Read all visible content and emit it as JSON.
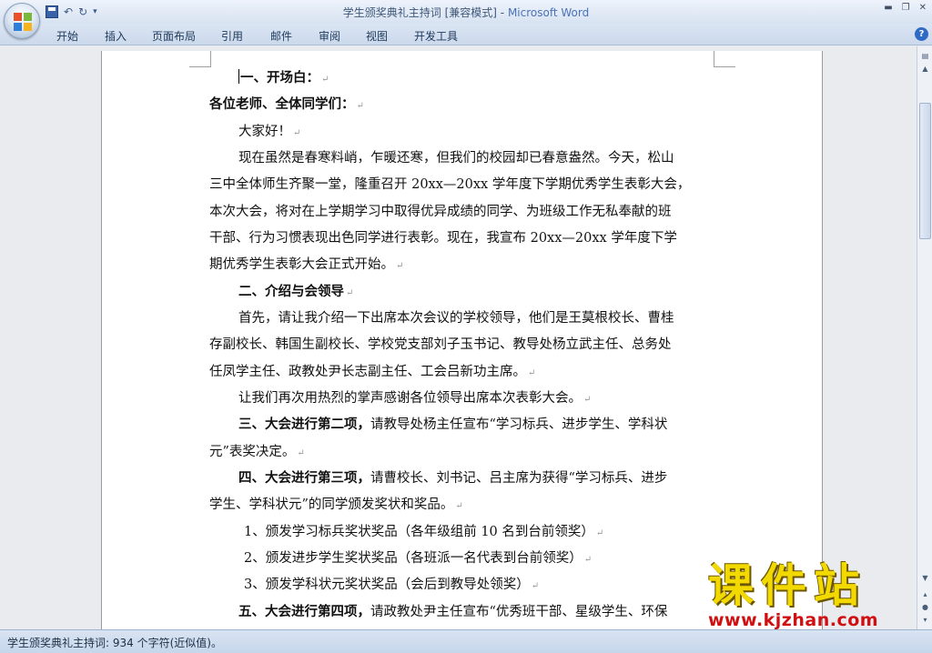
{
  "window": {
    "title": "学生颁奖典礼主持词 [兼容模式]",
    "title_sep": " - ",
    "app_name": "Microsoft Word"
  },
  "qat": {
    "undo": "↶",
    "redo": "↻",
    "customize": "▾"
  },
  "ribbon": {
    "tabs": [
      "开始",
      "插入",
      "页面布局",
      "引用",
      "邮件",
      "审阅",
      "视图",
      "开发工具"
    ],
    "help": "?"
  },
  "document": {
    "lines": [
      {
        "text": "一、开场白：",
        "bold": true
      },
      {
        "text": "各位老师、全体同学们：",
        "bold": true
      },
      {
        "text": "大家好！"
      },
      {
        "text": "现在虽然是春寒料峭，乍暖还寒，但我们的校园却已春意盎然。今天，松山"
      },
      {
        "text": "三中全体师生齐聚一堂，隆重召开 20xx—20xx 学年度下学期优秀学生表彰大会，"
      },
      {
        "text": "本次大会，将对在上学期学习中取得优异成绩的同学、为班级工作无私奉献的班"
      },
      {
        "text": "干部、行为习惯表现出色同学进行表彰。现在，我宣布 20xx—20xx 学年度下学"
      },
      {
        "text": "期优秀学生表彰大会正式开始。"
      },
      {
        "text": "二、介绍与会领导",
        "bold": true
      },
      {
        "text": "首先，请让我介绍一下出席本次会议的学校领导，他们是王莫根校长、曹桂"
      },
      {
        "text": "存副校长、韩国生副校长、学校党支部刘子玉书记、教导处杨立武主任、总务处"
      },
      {
        "text": "任凤学主任、政教处尹长志副主任、工会吕新功主席。"
      },
      {
        "text": "让我们再次用热烈的掌声感谢各位领导出席本次表彰大会。"
      },
      {
        "bold_part": "三、大会进行第二项，",
        "text": "请教导处杨主任宣布“学习标兵、进步学生、学科状"
      },
      {
        "text": "元”表奖决定。"
      },
      {
        "bold_part": "四、大会进行第三项，",
        "text": "请曹校长、刘书记、吕主席为获得“学习标兵、进步"
      },
      {
        "text": "学生、学科状元”的同学颁发奖状和奖品。"
      },
      {
        "text": "1、颁发学习标兵奖状奖品（各年级组前 10 名到台前领奖）"
      },
      {
        "text": "2、颁发进步学生奖状奖品（各班派一名代表到台前领奖）"
      },
      {
        "text": "3、颁发学科状元奖状奖品（会后到教导处领奖）"
      },
      {
        "bold_part": "五、大会进行第四项，",
        "text": "请政教处尹主任宣布“优秀班干部、星级学生、环保"
      }
    ],
    "para_mark": "↵"
  },
  "watermark": {
    "title": "课件站",
    "url": "www.kjzhan.com"
  },
  "statusbar": {
    "text": "学生颁奖典礼主持词: 934 个字符(近似值)。"
  },
  "colors": {
    "accent": "#4a72b8",
    "watermark_yellow": "#f2d900",
    "watermark_red": "#d01010"
  }
}
